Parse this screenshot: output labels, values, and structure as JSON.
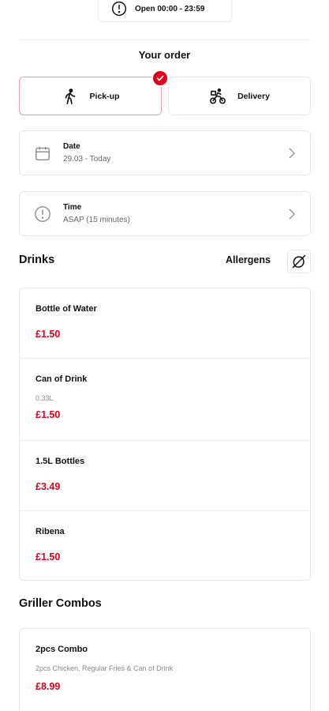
{
  "hours": {
    "text": "Open 00:00 - 23:59",
    "icon": "clock-icon"
  },
  "order": {
    "title": "Your order",
    "modes": [
      {
        "label": "Pick-up",
        "icon": "walking-person-icon",
        "selected": true
      },
      {
        "label": "Delivery",
        "icon": "cyclist-icon",
        "selected": false
      }
    ],
    "date": {
      "label": "Date",
      "value": "29.03 - Today"
    },
    "time": {
      "label": "Time",
      "value": "ASAP (15 minutes)"
    }
  },
  "drinks": {
    "title": "Drinks",
    "allergens_label": "Allergens",
    "items": [
      {
        "name": "Bottle of Water",
        "desc": "",
        "price": "£1.50"
      },
      {
        "name": "Can of Drink",
        "desc": "0.33L",
        "price": "£1.50"
      },
      {
        "name": "1.5L Bottles",
        "desc": "",
        "price": "£3.49"
      },
      {
        "name": "Ribena",
        "desc": "",
        "price": "£1.50"
      }
    ]
  },
  "combos": {
    "title": "Griller Combos",
    "items": [
      {
        "name": "2pcs Combo",
        "desc": "2pcs Chicken, Regular Fries & Can of Drink",
        "price": "£8.99"
      }
    ]
  },
  "colors": {
    "accent": "#e2001a",
    "border": "#e6e6e6",
    "selected_border": "#e8a0a6"
  }
}
